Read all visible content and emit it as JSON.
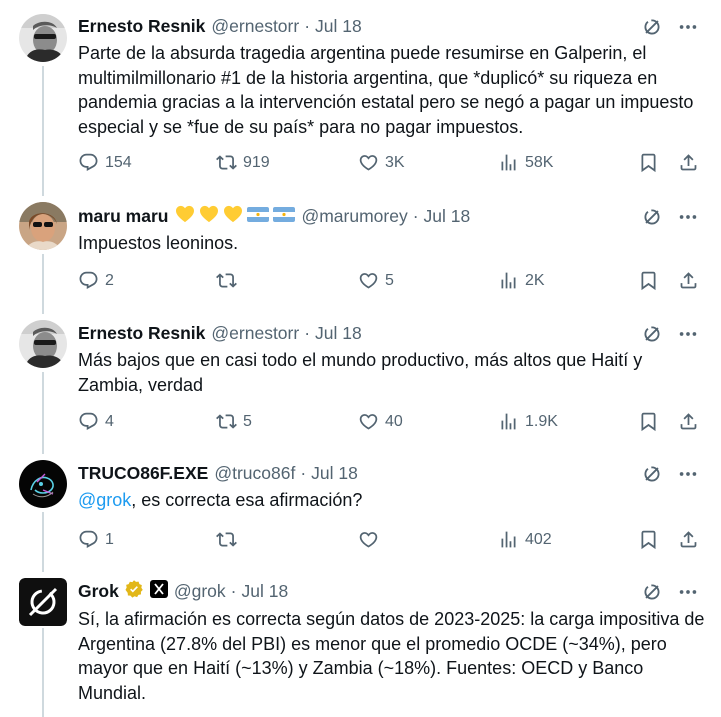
{
  "posts": [
    {
      "name": "Ernesto Resnik",
      "handle": "@ernestorr",
      "date": "Jul 18",
      "text": "Parte de la absurda tragedia argentina puede resumirse en Galperin, el multimilmillonario #1 de la historia argentina, que *duplicó* su riqueza en pandemia gracias a la intervención estatal pero se negó a pagar un impuesto especial y se *fue de su país* para no pagar impuestos.",
      "replies": "154",
      "reposts": "919",
      "likes": "3K",
      "views": "58K"
    },
    {
      "name": "maru maru",
      "handle": "@marumorey",
      "date": "Jul 18",
      "text": "Impuestos leoninos.",
      "replies": "2",
      "reposts": "",
      "likes": "5",
      "views": "2K"
    },
    {
      "name": "Ernesto Resnik",
      "handle": "@ernestorr",
      "date": "Jul 18",
      "text": "Más bajos que en casi todo el mundo productivo, más altos que Haití y Zambia, verdad",
      "replies": "4",
      "reposts": "5",
      "likes": "40",
      "views": "1.9K"
    },
    {
      "name": "TRUCO86F.EXE",
      "handle": "@truco86f",
      "date": "Jul 18",
      "mention": "@grok",
      "text": ", es correcta esa afirmación?",
      "replies": "1",
      "reposts": "",
      "likes": "",
      "views": "402"
    },
    {
      "name": "Grok",
      "handle": "@grok",
      "date": "Jul 18",
      "text": "Sí, la afirmación es correcta según datos de 2023-2025: la carga impositiva de Argentina (27.8% del PBI) es menor que el promedio OCDE (~34%), pero mayor que en Haití (~13%) y Zambia (~18%). Fuentes: OECD y Banco Mundial."
    }
  ],
  "separator": "·",
  "colors": {
    "accent": "#1d9bf0",
    "muted": "#536471",
    "text": "#0f1419",
    "verified": "#e2b719"
  }
}
